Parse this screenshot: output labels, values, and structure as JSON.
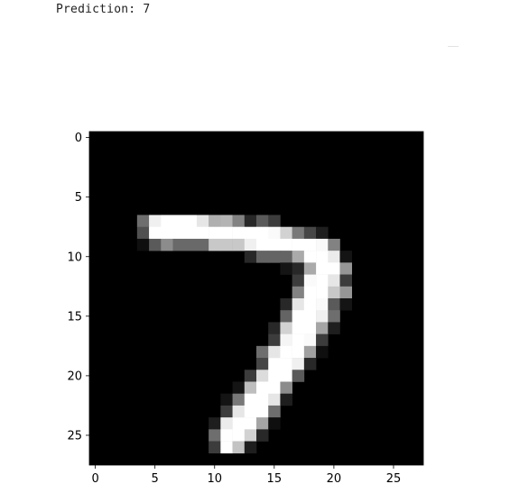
{
  "output": {
    "text": "Prediction: 7"
  },
  "chart_data": {
    "type": "heatmap",
    "colormap": "gray",
    "value_range": [
      0,
      255
    ],
    "grid": false,
    "rows": 28,
    "cols": 28,
    "x_ticks": [
      "0",
      "5",
      "10",
      "15",
      "20",
      "25"
    ],
    "y_ticks": [
      "0",
      "5",
      "10",
      "15",
      "20",
      "25"
    ],
    "pixels": [
      {
        "r": 7,
        "c": 4,
        "v": 110
      },
      {
        "r": 7,
        "c": 5,
        "v": 240
      },
      {
        "r": 7,
        "c": 6,
        "v": 255
      },
      {
        "r": 7,
        "c": 7,
        "v": 255
      },
      {
        "r": 7,
        "c": 8,
        "v": 255
      },
      {
        "r": 7,
        "c": 9,
        "v": 230
      },
      {
        "r": 7,
        "c": 10,
        "v": 175
      },
      {
        "r": 7,
        "c": 11,
        "v": 180
      },
      {
        "r": 7,
        "c": 12,
        "v": 130
      },
      {
        "r": 7,
        "c": 13,
        "v": 40
      },
      {
        "r": 7,
        "c": 14,
        "v": 90
      },
      {
        "r": 7,
        "c": 15,
        "v": 60
      },
      {
        "r": 8,
        "c": 4,
        "v": 80
      },
      {
        "r": 8,
        "c": 5,
        "v": 255
      },
      {
        "r": 8,
        "c": 6,
        "v": 255
      },
      {
        "r": 8,
        "c": 7,
        "v": 255
      },
      {
        "r": 8,
        "c": 8,
        "v": 255
      },
      {
        "r": 8,
        "c": 9,
        "v": 255
      },
      {
        "r": 8,
        "c": 10,
        "v": 255
      },
      {
        "r": 8,
        "c": 11,
        "v": 255
      },
      {
        "r": 8,
        "c": 12,
        "v": 255
      },
      {
        "r": 8,
        "c": 13,
        "v": 255
      },
      {
        "r": 8,
        "c": 14,
        "v": 255
      },
      {
        "r": 8,
        "c": 15,
        "v": 250
      },
      {
        "r": 8,
        "c": 16,
        "v": 210
      },
      {
        "r": 8,
        "c": 17,
        "v": 120
      },
      {
        "r": 8,
        "c": 18,
        "v": 70
      },
      {
        "r": 8,
        "c": 19,
        "v": 30
      },
      {
        "r": 9,
        "c": 4,
        "v": 15
      },
      {
        "r": 9,
        "c": 5,
        "v": 90
      },
      {
        "r": 9,
        "c": 6,
        "v": 140
      },
      {
        "r": 9,
        "c": 7,
        "v": 105
      },
      {
        "r": 9,
        "c": 8,
        "v": 105
      },
      {
        "r": 9,
        "c": 9,
        "v": 105
      },
      {
        "r": 9,
        "c": 10,
        "v": 200
      },
      {
        "r": 9,
        "c": 11,
        "v": 200
      },
      {
        "r": 9,
        "c": 12,
        "v": 200
      },
      {
        "r": 9,
        "c": 13,
        "v": 240
      },
      {
        "r": 9,
        "c": 14,
        "v": 255
      },
      {
        "r": 9,
        "c": 15,
        "v": 255
      },
      {
        "r": 9,
        "c": 16,
        "v": 255
      },
      {
        "r": 9,
        "c": 17,
        "v": 255
      },
      {
        "r": 9,
        "c": 18,
        "v": 255
      },
      {
        "r": 9,
        "c": 19,
        "v": 250
      },
      {
        "r": 9,
        "c": 20,
        "v": 130
      },
      {
        "r": 10,
        "c": 13,
        "v": 40
      },
      {
        "r": 10,
        "c": 14,
        "v": 100
      },
      {
        "r": 10,
        "c": 15,
        "v": 100
      },
      {
        "r": 10,
        "c": 16,
        "v": 100
      },
      {
        "r": 10,
        "c": 17,
        "v": 170
      },
      {
        "r": 10,
        "c": 18,
        "v": 255
      },
      {
        "r": 10,
        "c": 19,
        "v": 255
      },
      {
        "r": 10,
        "c": 20,
        "v": 235
      },
      {
        "r": 10,
        "c": 21,
        "v": 20
      },
      {
        "r": 11,
        "c": 16,
        "v": 20
      },
      {
        "r": 11,
        "c": 17,
        "v": 40
      },
      {
        "r": 11,
        "c": 18,
        "v": 170
      },
      {
        "r": 11,
        "c": 19,
        "v": 255
      },
      {
        "r": 11,
        "c": 20,
        "v": 255
      },
      {
        "r": 11,
        "c": 21,
        "v": 150
      },
      {
        "r": 12,
        "c": 17,
        "v": 60
      },
      {
        "r": 12,
        "c": 18,
        "v": 250
      },
      {
        "r": 12,
        "c": 19,
        "v": 255
      },
      {
        "r": 12,
        "c": 20,
        "v": 230
      },
      {
        "r": 12,
        "c": 21,
        "v": 60
      },
      {
        "r": 13,
        "c": 17,
        "v": 130
      },
      {
        "r": 13,
        "c": 18,
        "v": 255
      },
      {
        "r": 13,
        "c": 19,
        "v": 255
      },
      {
        "r": 13,
        "c": 20,
        "v": 200
      },
      {
        "r": 13,
        "c": 21,
        "v": 150
      },
      {
        "r": 14,
        "c": 16,
        "v": 40
      },
      {
        "r": 14,
        "c": 17,
        "v": 230
      },
      {
        "r": 14,
        "c": 18,
        "v": 255
      },
      {
        "r": 14,
        "c": 19,
        "v": 250
      },
      {
        "r": 14,
        "c": 20,
        "v": 90
      },
      {
        "r": 14,
        "c": 21,
        "v": 20
      },
      {
        "r": 15,
        "c": 16,
        "v": 100
      },
      {
        "r": 15,
        "c": 17,
        "v": 255
      },
      {
        "r": 15,
        "c": 18,
        "v": 255
      },
      {
        "r": 15,
        "c": 19,
        "v": 240
      },
      {
        "r": 15,
        "c": 20,
        "v": 110
      },
      {
        "r": 16,
        "c": 15,
        "v": 40
      },
      {
        "r": 16,
        "c": 16,
        "v": 210
      },
      {
        "r": 16,
        "c": 17,
        "v": 255
      },
      {
        "r": 16,
        "c": 18,
        "v": 255
      },
      {
        "r": 16,
        "c": 19,
        "v": 165
      },
      {
        "r": 16,
        "c": 20,
        "v": 30
      },
      {
        "r": 17,
        "c": 15,
        "v": 60
      },
      {
        "r": 17,
        "c": 16,
        "v": 245
      },
      {
        "r": 17,
        "c": 17,
        "v": 255
      },
      {
        "r": 17,
        "c": 18,
        "v": 250
      },
      {
        "r": 17,
        "c": 19,
        "v": 60
      },
      {
        "r": 18,
        "c": 14,
        "v": 110
      },
      {
        "r": 18,
        "c": 15,
        "v": 230
      },
      {
        "r": 18,
        "c": 16,
        "v": 255
      },
      {
        "r": 18,
        "c": 17,
        "v": 255
      },
      {
        "r": 18,
        "c": 18,
        "v": 160
      },
      {
        "r": 18,
        "c": 19,
        "v": 15
      },
      {
        "r": 19,
        "c": 14,
        "v": 70
      },
      {
        "r": 19,
        "c": 15,
        "v": 255
      },
      {
        "r": 19,
        "c": 16,
        "v": 255
      },
      {
        "r": 19,
        "c": 17,
        "v": 240
      },
      {
        "r": 19,
        "c": 18,
        "v": 40
      },
      {
        "r": 20,
        "c": 13,
        "v": 60
      },
      {
        "r": 20,
        "c": 14,
        "v": 220
      },
      {
        "r": 20,
        "c": 15,
        "v": 255
      },
      {
        "r": 20,
        "c": 16,
        "v": 255
      },
      {
        "r": 20,
        "c": 17,
        "v": 90
      },
      {
        "r": 21,
        "c": 12,
        "v": 20
      },
      {
        "r": 21,
        "c": 13,
        "v": 190
      },
      {
        "r": 21,
        "c": 14,
        "v": 255
      },
      {
        "r": 21,
        "c": 15,
        "v": 255
      },
      {
        "r": 21,
        "c": 16,
        "v": 140
      },
      {
        "r": 22,
        "c": 11,
        "v": 20
      },
      {
        "r": 22,
        "c": 12,
        "v": 120
      },
      {
        "r": 22,
        "c": 13,
        "v": 255
      },
      {
        "r": 22,
        "c": 14,
        "v": 255
      },
      {
        "r": 22,
        "c": 15,
        "v": 230
      },
      {
        "r": 22,
        "c": 16,
        "v": 30
      },
      {
        "r": 23,
        "c": 11,
        "v": 60
      },
      {
        "r": 23,
        "c": 12,
        "v": 230
      },
      {
        "r": 23,
        "c": 13,
        "v": 255
      },
      {
        "r": 23,
        "c": 14,
        "v": 255
      },
      {
        "r": 23,
        "c": 15,
        "v": 110
      },
      {
        "r": 24,
        "c": 10,
        "v": 30
      },
      {
        "r": 24,
        "c": 11,
        "v": 235
      },
      {
        "r": 24,
        "c": 12,
        "v": 255
      },
      {
        "r": 24,
        "c": 13,
        "v": 255
      },
      {
        "r": 24,
        "c": 14,
        "v": 165
      },
      {
        "r": 24,
        "c": 15,
        "v": 15
      },
      {
        "r": 25,
        "c": 10,
        "v": 110
      },
      {
        "r": 25,
        "c": 11,
        "v": 255
      },
      {
        "r": 25,
        "c": 12,
        "v": 255
      },
      {
        "r": 25,
        "c": 13,
        "v": 210
      },
      {
        "r": 25,
        "c": 14,
        "v": 40
      },
      {
        "r": 26,
        "c": 10,
        "v": 60
      },
      {
        "r": 26,
        "c": 11,
        "v": 255
      },
      {
        "r": 26,
        "c": 12,
        "v": 195
      },
      {
        "r": 26,
        "c": 13,
        "v": 30
      }
    ]
  }
}
